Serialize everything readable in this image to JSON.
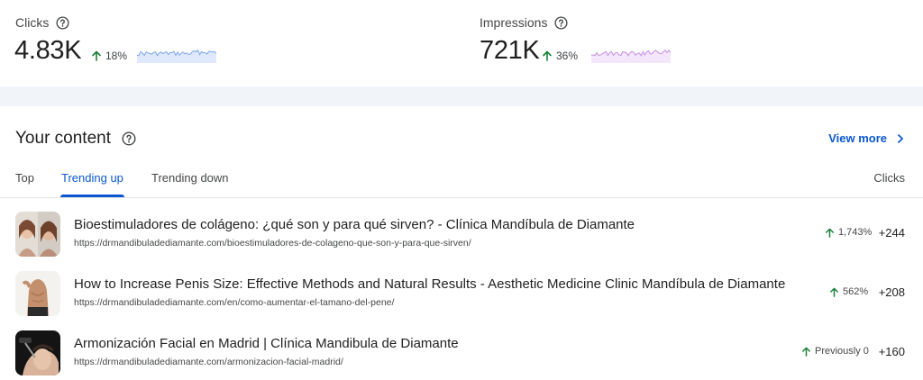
{
  "metrics": {
    "clicks": {
      "title": "Clicks",
      "value": "4.83K",
      "change": "18%",
      "spark_color": "#7aa6e8",
      "spark_fill": "#dfe9fb"
    },
    "impressions": {
      "title": "Impressions",
      "value": "721K",
      "change": "36%",
      "spark_color": "#c58ddf",
      "spark_fill": "#f4e6fb"
    }
  },
  "content": {
    "title": "Your content",
    "view_more": "View more",
    "tabs": [
      "Top",
      "Trending up",
      "Trending down"
    ],
    "active_tab": "Trending up",
    "column_header": "Clicks",
    "rows": [
      {
        "title": "Bioestimuladores de colágeno: ¿qué son y para qué sirven? - Clínica Mandíbula de Diamante",
        "url": "https://drmandibuladediamante.com/bioestimuladores-de-colageno-que-son-y-para-que-sirven/",
        "change": "1,743%",
        "clicks": "+244",
        "thumb": "two-faces-photo"
      },
      {
        "title": "How to Increase Penis Size: Effective Methods and Natural Results - Aesthetic Medicine Clinic Mandíbula de Diamante",
        "url": "https://drmandibuladediamante.com/en/como-aumentar-el-tamano-del-pene/",
        "change": "562%",
        "clicks": "+208",
        "thumb": "torso-photo"
      },
      {
        "title": "Armonización Facial en Madrid | Clínica Mandibula de Diamante",
        "url": "https://drmandibuladediamante.com/armonizacion-facial-madrid/",
        "change": "Previously 0",
        "clicks": "+160",
        "thumb": "face-treatment-photo"
      }
    ]
  },
  "colors": {
    "accent": "#0b57d0",
    "trend_up": "#188038",
    "band": "#f1f4f9"
  }
}
